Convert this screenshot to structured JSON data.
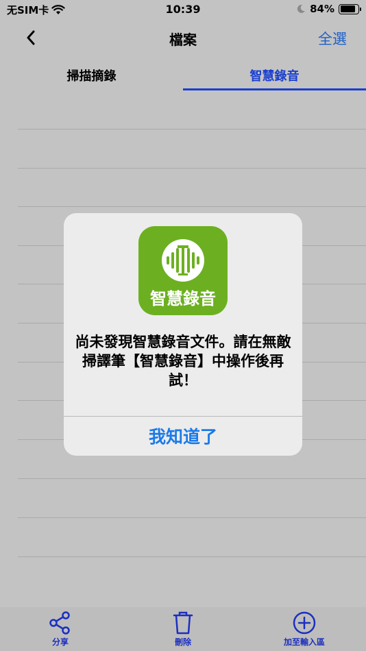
{
  "status": {
    "carrier": "无SIM卡",
    "time": "10:39",
    "battery_pct_text": "84%",
    "battery_level": 0.84
  },
  "nav": {
    "title": "檔案",
    "select_all": "全選"
  },
  "tabs": [
    {
      "label": "掃描摘錄",
      "active": false
    },
    {
      "label": "智慧錄音",
      "active": true
    }
  ],
  "dialog": {
    "icon_text": "智慧錄音",
    "message": "尚未發現智慧錄音文件。請在無敵掃譯筆【智慧錄音】中操作後再試！",
    "button": "我知道了"
  },
  "toolbar": {
    "share": "分享",
    "delete": "刪除",
    "add_to_input": "加至輸入區"
  },
  "colors": {
    "accent": "#1a3fd1",
    "link": "#1d5fc7",
    "app_green": "#6cb021",
    "dialog_button": "#1a7ae8"
  }
}
